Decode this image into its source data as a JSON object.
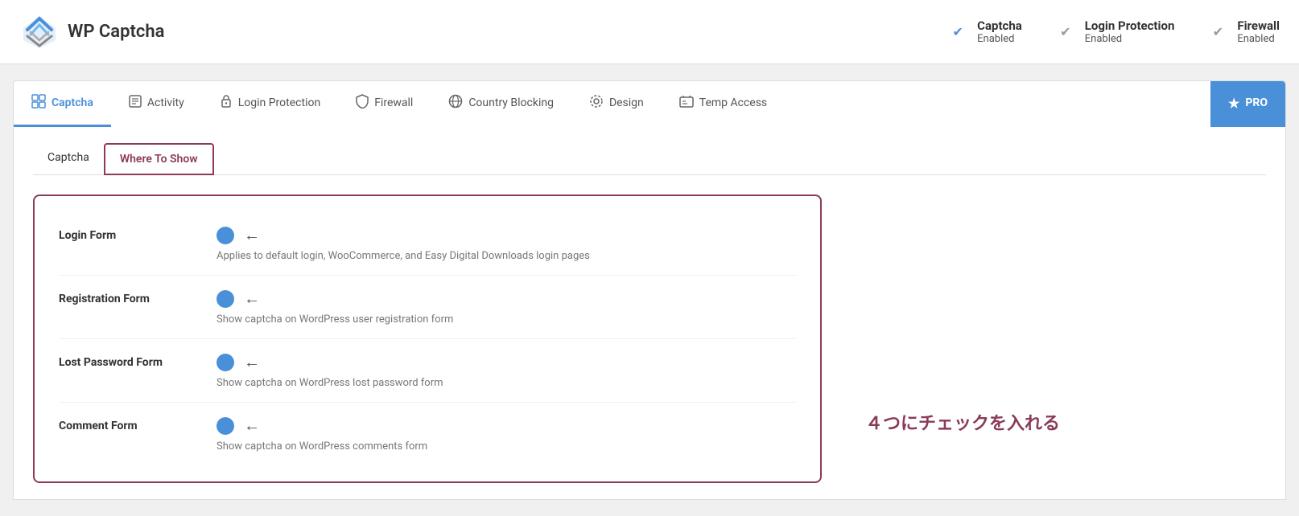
{
  "header": {
    "logo_text": "WP Captcha",
    "status_items": [
      {
        "key": "captcha",
        "title": "Captcha",
        "subtitle": "Enabled",
        "active": true
      },
      {
        "key": "login_protection",
        "title": "Login Protection",
        "subtitle": "Enabled",
        "active": false
      },
      {
        "key": "firewall",
        "title": "Firewall",
        "subtitle": "Enabled",
        "active": false
      }
    ]
  },
  "tabs": [
    {
      "key": "captcha",
      "label": "Captcha",
      "icon": "🔲",
      "active": true
    },
    {
      "key": "activity",
      "label": "Activity",
      "icon": "📄",
      "active": false
    },
    {
      "key": "login_protection",
      "label": "Login Protection",
      "icon": "🔐",
      "active": false
    },
    {
      "key": "firewall",
      "label": "Firewall",
      "icon": "🛡",
      "active": false
    },
    {
      "key": "country_blocking",
      "label": "Country Blocking",
      "icon": "🌐",
      "active": false
    },
    {
      "key": "design",
      "label": "Design",
      "icon": "⚙️",
      "active": false
    },
    {
      "key": "temp_access",
      "label": "Temp Access",
      "icon": "⏳",
      "active": false
    },
    {
      "key": "pro",
      "label": "PRO",
      "icon": "★",
      "active": false,
      "isPro": true
    }
  ],
  "sub_tabs": [
    {
      "key": "captcha",
      "label": "Captcha",
      "active": false
    },
    {
      "key": "where_to_show",
      "label": "Where To Show",
      "active": true
    }
  ],
  "settings_box": {
    "rows": [
      {
        "key": "login_form",
        "label": "Login Form",
        "description": "Applies to default login, WooCommerce, and Easy Digital Downloads login pages",
        "enabled": true
      },
      {
        "key": "registration_form",
        "label": "Registration Form",
        "description": "Show captcha on WordPress user registration form",
        "enabled": true
      },
      {
        "key": "lost_password_form",
        "label": "Lost Password Form",
        "description": "Show captcha on WordPress lost password form",
        "enabled": true
      },
      {
        "key": "comment_form",
        "label": "Comment Form",
        "description": "Show captcha on WordPress comments form",
        "enabled": true
      }
    ]
  },
  "annotation": "４つにチェックを入れる"
}
